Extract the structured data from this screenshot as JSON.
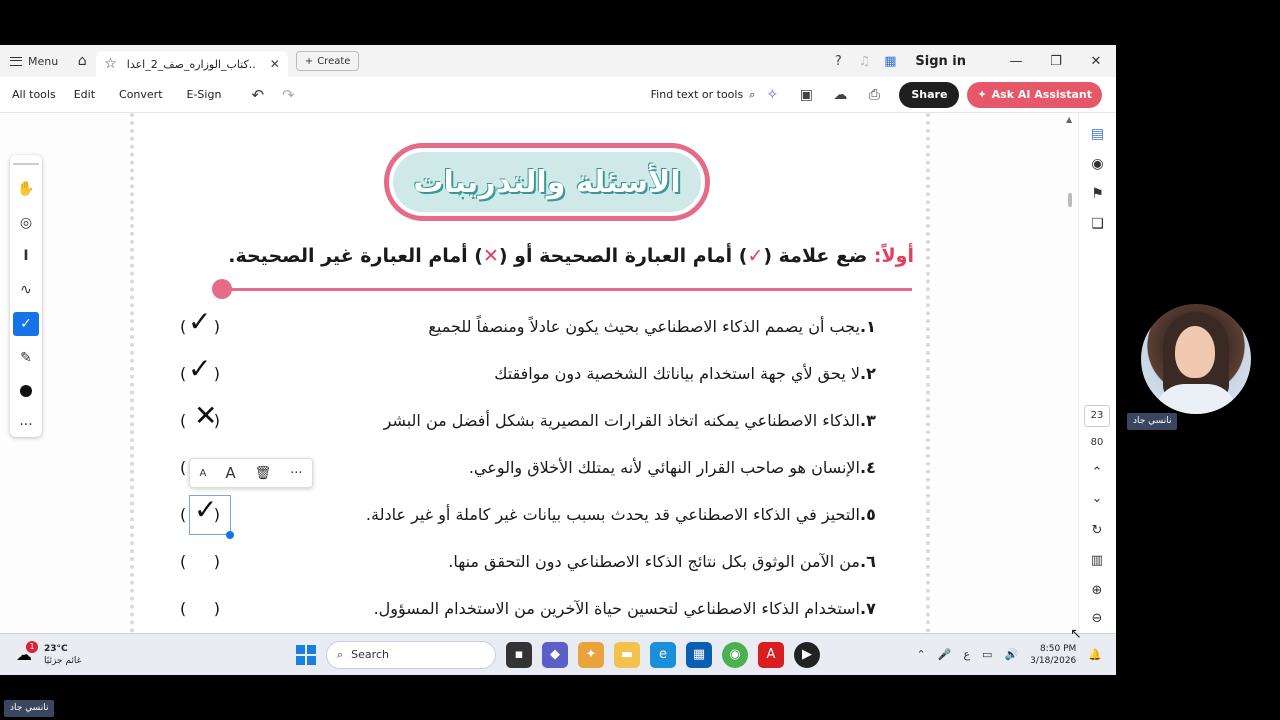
{
  "titlebar": {
    "menu_label": "Menu",
    "tab_title": "كتاب_الوزاره_صف_2_اعدا..",
    "create_label": "Create",
    "signin_label": "Sign in"
  },
  "toolbar": {
    "all_tools": "All tools",
    "edit": "Edit",
    "convert": "Convert",
    "esign": "E-Sign",
    "find_label": "Find text or tools",
    "share_label": "Share",
    "ai_label": "Ask AI Assistant"
  },
  "document": {
    "banner_title": "الأسئلة والتدريبات",
    "heading_prefix": "أولاً:",
    "heading_text_1": " ضع علامة (",
    "heading_check": "✓",
    "heading_text_2": ") أمام العبارة الصحيحة أو (",
    "heading_cross": "✕",
    "heading_text_3": ") أمام العبارة غير الصحيحة.",
    "questions": [
      {
        "num": "١.",
        "text": "يجب أن يصمم الذكاء الاصطناعي بحيث يكون عادلاً ومنصفاً للجميع",
        "open": "(",
        "close": ")",
        "mark": "✓"
      },
      {
        "num": "٢.",
        "text": "لا يحق لأي جهة استخدام بياناتك الشخصية دون موافقتك",
        "open": "(",
        "close": ")",
        "mark": "✓"
      },
      {
        "num": "٣.",
        "text": "الذكاء الاصطناعي يمكنه اتخاذ القرارات المصيرية بشكل أفضل من البشر",
        "open": "(",
        "close": ")",
        "mark": "✕"
      },
      {
        "num": "٤.",
        "text": "الإنسان هو صاحب القرار النهائي لأنه يمتلك الأخلاق والوعي.",
        "open": "(",
        "close": ")",
        "mark": ""
      },
      {
        "num": "٥.",
        "text": "التحيز في الذكاء الاصطناعي قد يحدث بسبب بيانات غير كاملة أو غير عادلة.",
        "open": "(",
        "close": ")",
        "mark": "✓"
      },
      {
        "num": "٦.",
        "text": "من الآمن الوثوق بكل نتائج الذكاء الاصطناعي دون التحقق منها.",
        "open": "(",
        "close": ")",
        "mark": ""
      },
      {
        "num": "٧.",
        "text": "استخدام الذكاء الاصطناعي لتحسين حياة الآخرين من الاستخدام المسؤول.",
        "open": "(",
        "close": ")",
        "mark": ""
      }
    ],
    "context_menu": {
      "small_a": "A",
      "large_a": "A",
      "more": "···"
    }
  },
  "navigation": {
    "current_page": "23",
    "total_pages": "80"
  },
  "taskbar": {
    "temperature": "23°C",
    "weather_desc": "غائم جزئيًا",
    "weather_badge": "1",
    "search_placeholder": "Search",
    "ime": "ع",
    "time": "8:50 PM",
    "date": "3/18/2026"
  },
  "webcam": {
    "participant_name": "نانسي جاد"
  },
  "colors": {
    "accent_pink": "#e56b88",
    "banner_teal": "#cfe9e8",
    "ai_button": "#e6576a",
    "share_button": "#1f1f1f"
  }
}
